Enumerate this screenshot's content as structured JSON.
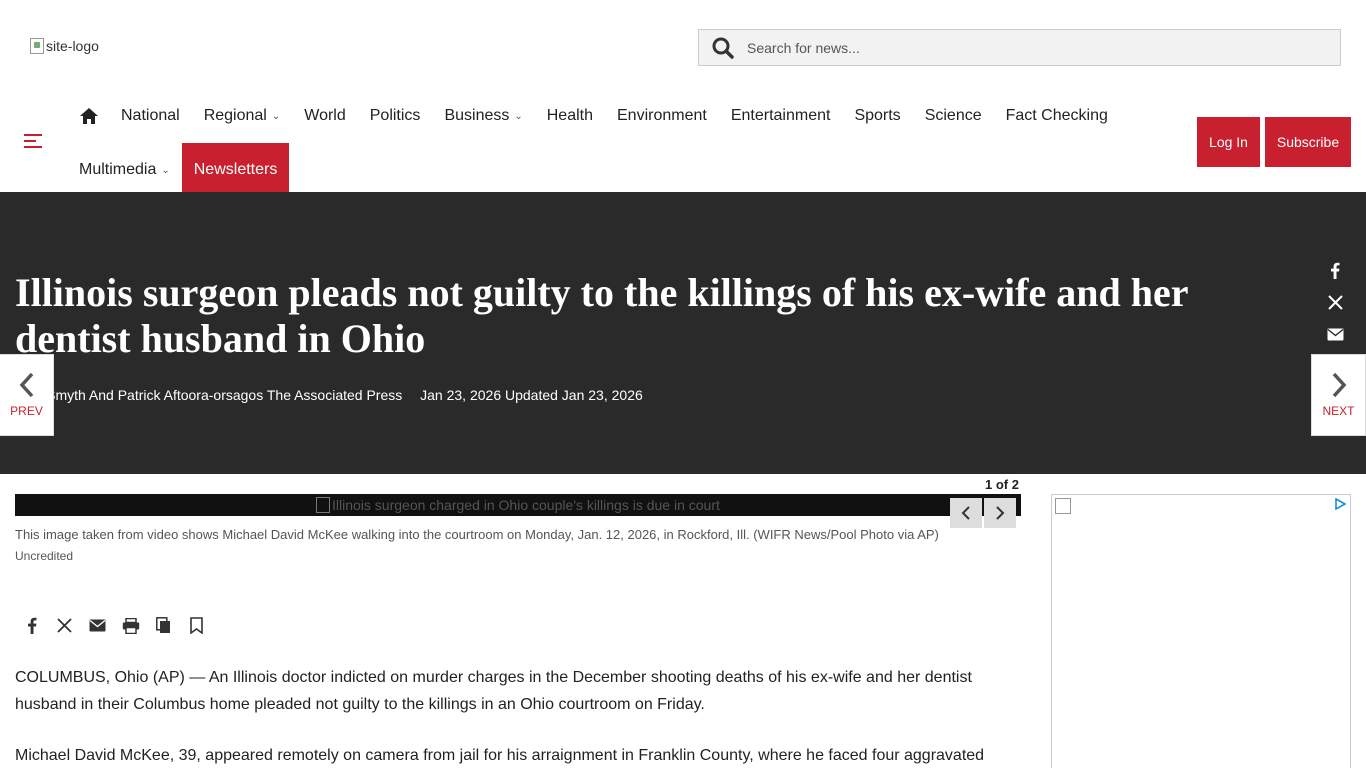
{
  "header": {
    "logo_alt": "site-logo",
    "search_placeholder": "Search for news...",
    "login": "Log In",
    "subscribe": "Subscribe"
  },
  "nav": {
    "row1": [
      "National",
      "Regional",
      "World",
      "Politics",
      "Business",
      "Health",
      "Environment",
      "Entertainment",
      "Sports",
      "Science",
      "Fact Checking"
    ],
    "row2": [
      "Multimedia",
      "Newsletters"
    ]
  },
  "article": {
    "headline": "Illinois surgeon pleads not guilty to the killings of his ex-wife and her dentist husband in Ohio",
    "byline": "Carr Smyth And Patrick Aftoora-orsagos The Associated Press",
    "dates": "Jan 23, 2026 Updated Jan 23, 2026",
    "prev_label": "PREV",
    "next_label": "NEXT",
    "gallery_count": "1 of 2",
    "image_alt": "Illinois surgeon charged in Ohio couple's killings is due in court",
    "caption": "This image taken from video shows Michael David McKee walking into the courtroom on Monday, Jan. 12, 2026, in Rockford, Ill. (WIFR News/Pool Photo via AP)",
    "credit": "Uncredited",
    "paragraphs": [
      "COLUMBUS, Ohio (AP) — An Illinois doctor indicted on murder charges in the December shooting deaths of his ex-wife and her dentist husband in their Columbus home pleaded not guilty to the killings in an Ohio courtroom on Friday.",
      "Michael David McKee, 39, appeared remotely on camera from jail for his arraignment in Franklin County, where he faced four aggravated"
    ]
  },
  "colors": {
    "accent": "#c8202f",
    "hero_bg": "#2a2a2a"
  },
  "icons": [
    "search-icon",
    "home-icon",
    "menu-icon",
    "facebook-icon",
    "x-icon",
    "email-icon",
    "print-icon",
    "copy-icon",
    "bookmark-icon",
    "chevron-left-icon",
    "chevron-right-icon",
    "adchoices-icon"
  ]
}
